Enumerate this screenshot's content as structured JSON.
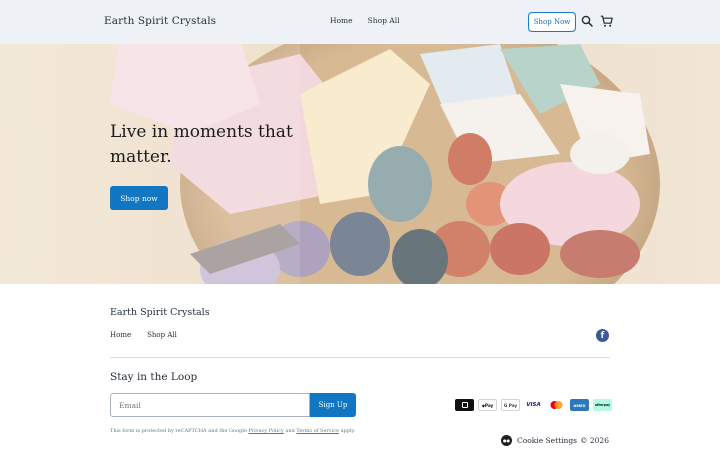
{
  "header": {
    "brand": "Earth Spirit Crystals",
    "nav": [
      "Home",
      "Shop All"
    ],
    "shop_now_label": "Shop Now",
    "icons": [
      "search-icon",
      "cart-icon"
    ]
  },
  "hero": {
    "headline": "Live in moments that matter.",
    "cta_label": "Shop now",
    "image": "bowl of tumbled crystals and gemstones"
  },
  "footer": {
    "brand": "Earth Spirit Crystals",
    "nav": [
      "Home",
      "Shop All"
    ],
    "social": [
      "facebook-icon"
    ],
    "newsletter": {
      "title": "Stay in the Loop",
      "email_placeholder": "Email",
      "signup_label": "Sign Up",
      "legal_prefix": "This form is protected by reCAPTCHA and the Google ",
      "privacy_label": "Privacy Policy",
      "legal_and": " and ",
      "terms_label": "Terms of Service",
      "legal_suffix": " apply."
    },
    "payment_methods": [
      "Square",
      "Apple Pay",
      "Google Pay",
      "VISA",
      "Mastercard",
      "AMEX",
      "afterpay"
    ],
    "cookie_settings_label": "Cookie Settings",
    "copyright": "© 2026"
  },
  "colors": {
    "header_bg": "#eef2f7",
    "accent": "#1177c2",
    "text": "#1f2a36"
  }
}
